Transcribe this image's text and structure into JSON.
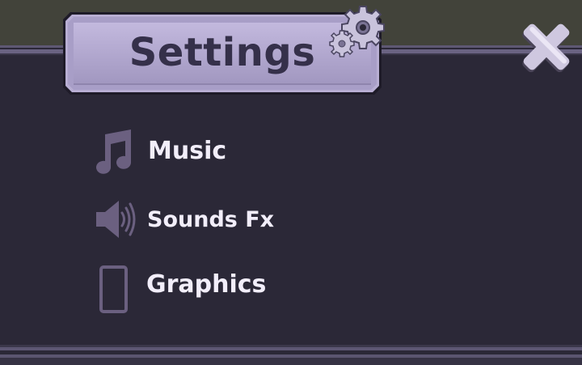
{
  "window": {
    "title": "Settings",
    "title_icon": "gears-icon",
    "close_icon": "close-x-icon"
  },
  "menu": {
    "items": [
      {
        "id": "music",
        "label": "Music",
        "icon": "music-note-icon"
      },
      {
        "id": "sounds",
        "label": "Sounds Fx",
        "icon": "speaker-icon"
      },
      {
        "id": "graphics",
        "label": "Graphics",
        "icon": "phone-screen-icon"
      }
    ]
  },
  "colors": {
    "background": "#2b2837",
    "top_strip": "#42433a",
    "banner": "#a59bc4",
    "title_text": "#35304a",
    "icon": "#6b6080",
    "label": "#f2eefa"
  }
}
